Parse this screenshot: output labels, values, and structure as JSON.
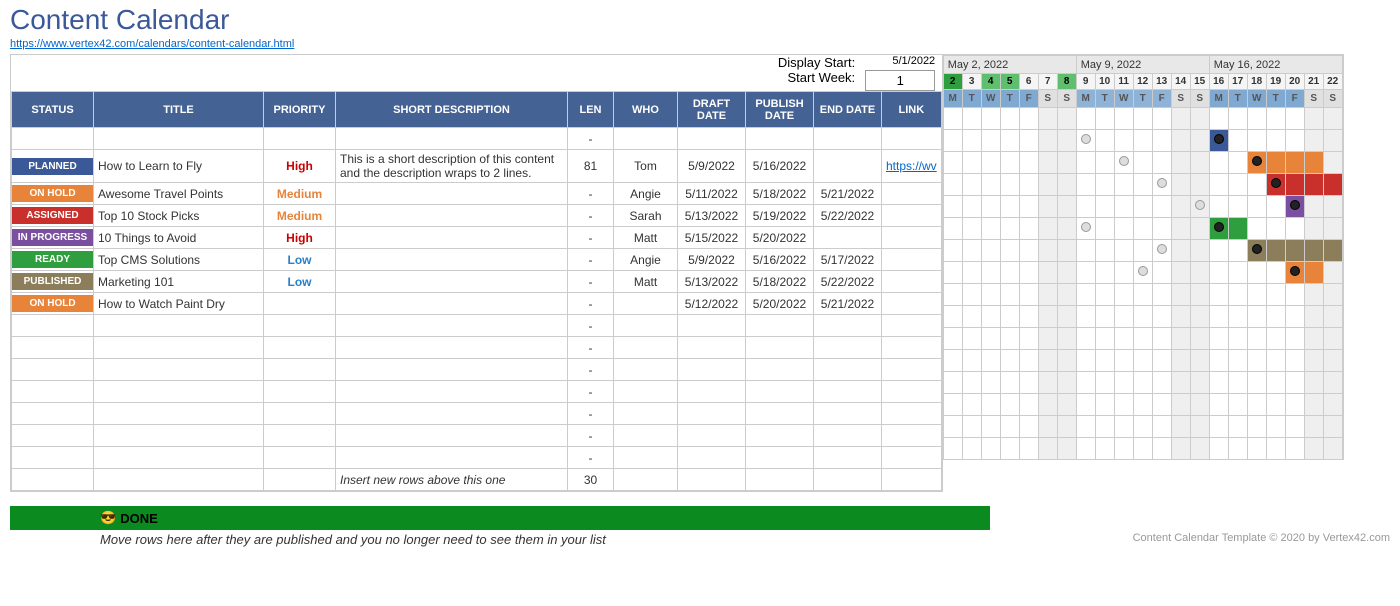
{
  "header": {
    "title": "Content Calendar",
    "source_link": "https://www.vertex42.com/calendars/content-calendar.html",
    "display_start_label": "Display Start:",
    "display_start_value": "5/1/2022",
    "start_week_label": "Start Week:",
    "start_week_value": "1"
  },
  "columns": {
    "status": "STATUS",
    "title": "TITLE",
    "priority": "PRIORITY",
    "desc": "SHORT DESCRIPTION",
    "len": "LEN",
    "who": "WHO",
    "draft": "DRAFT DATE",
    "publish": "PUBLISH DATE",
    "end": "END DATE",
    "link": "LINK"
  },
  "status_labels": {
    "planned": "PLANNED",
    "onhold": "ON HOLD",
    "assigned": "ASSIGNED",
    "progress": "IN PROGRESS",
    "ready": "READY",
    "published": "PUBLISHED"
  },
  "priority_labels": {
    "high": "High",
    "medium": "Medium",
    "low": "Low"
  },
  "rows": [
    {
      "status": "",
      "title": "",
      "priority": "",
      "desc": "",
      "len": "-",
      "who": "",
      "draft": "",
      "publish": "",
      "end": "",
      "link": ""
    },
    {
      "status": "planned",
      "title": "How to Learn to Fly",
      "priority": "high",
      "desc": "This is a short description of this content and the description wraps to 2 lines.",
      "len": "81",
      "who": "Tom",
      "draft": "5/9/2022",
      "publish": "5/16/2022",
      "end": "",
      "link": "https://wv",
      "gantt": {
        "draft_col": 7,
        "publish_col": 14,
        "fill": "f-blue",
        "range": [
          14,
          14
        ]
      }
    },
    {
      "status": "onhold",
      "title": "Awesome Travel Points",
      "priority": "medium",
      "desc": "",
      "len": "-",
      "who": "Angie",
      "draft": "5/11/2022",
      "publish": "5/18/2022",
      "end": "5/21/2022",
      "link": "",
      "gantt": {
        "draft_col": 9,
        "publish_col": 16,
        "fill": "f-orange",
        "range": [
          16,
          19
        ]
      }
    },
    {
      "status": "assigned",
      "title": "Top 10 Stock Picks",
      "priority": "medium",
      "desc": "",
      "len": "-",
      "who": "Sarah",
      "draft": "5/13/2022",
      "publish": "5/19/2022",
      "end": "5/22/2022",
      "link": "",
      "gantt": {
        "draft_col": 11,
        "publish_col": 17,
        "fill": "f-red",
        "range": [
          17,
          20
        ]
      }
    },
    {
      "status": "progress",
      "title": "10 Things to Avoid",
      "priority": "high",
      "desc": "",
      "len": "-",
      "who": "Matt",
      "draft": "5/15/2022",
      "publish": "5/20/2022",
      "end": "",
      "link": "",
      "gantt": {
        "draft_col": 13,
        "publish_col": 18,
        "fill": "f-purple",
        "range": [
          18,
          18
        ]
      }
    },
    {
      "status": "ready",
      "title": "Top CMS Solutions",
      "priority": "low",
      "desc": "",
      "len": "-",
      "who": "Angie",
      "draft": "5/9/2022",
      "publish": "5/16/2022",
      "end": "5/17/2022",
      "link": "",
      "gantt": {
        "draft_col": 7,
        "publish_col": 14,
        "fill": "f-green",
        "range": [
          14,
          15
        ]
      }
    },
    {
      "status": "published",
      "title": "Marketing 101",
      "priority": "low",
      "desc": "",
      "len": "-",
      "who": "Matt",
      "draft": "5/13/2022",
      "publish": "5/18/2022",
      "end": "5/22/2022",
      "link": "",
      "gantt": {
        "draft_col": 11,
        "publish_col": 16,
        "fill": "f-brown",
        "range": [
          16,
          20
        ]
      }
    },
    {
      "status": "onhold",
      "title": "How to Watch Paint Dry",
      "priority": "",
      "desc": "",
      "len": "-",
      "who": "",
      "draft": "5/12/2022",
      "publish": "5/20/2022",
      "end": "5/21/2022",
      "link": "",
      "gantt": {
        "draft_col": 10,
        "publish_col": 18,
        "fill": "f-orange",
        "range": [
          18,
          19
        ]
      }
    },
    {
      "len": "-"
    },
    {
      "len": "-"
    },
    {
      "len": "-"
    },
    {
      "len": "-"
    },
    {
      "len": "-"
    },
    {
      "len": "-"
    },
    {
      "len": "-"
    },
    {
      "desc": "Insert new rows above this one",
      "len": "30",
      "italic": true
    }
  ],
  "gantt": {
    "weeks": [
      "May 2, 2022",
      "May 9, 2022",
      "May 16, 2022"
    ],
    "days": [
      2,
      3,
      4,
      5,
      6,
      7,
      8,
      9,
      10,
      11,
      12,
      13,
      14,
      15,
      16,
      17,
      18,
      19,
      20,
      21,
      22
    ],
    "today_cols": [
      0,
      2,
      3,
      6
    ],
    "dow": [
      "M",
      "T",
      "W",
      "T",
      "F",
      "S",
      "S",
      "M",
      "T",
      "W",
      "T",
      "F",
      "S",
      "S",
      "M",
      "T",
      "W",
      "T",
      "F",
      "S",
      "S"
    ],
    "weekend_cols": [
      5,
      6,
      12,
      13,
      19,
      20
    ]
  },
  "done": {
    "label": "DONE",
    "emoji": "😎",
    "note": "Move rows here after they are published and you no longer need to see them in your list",
    "footer": "Content Calendar Template © 2020 by Vertex42.com"
  }
}
